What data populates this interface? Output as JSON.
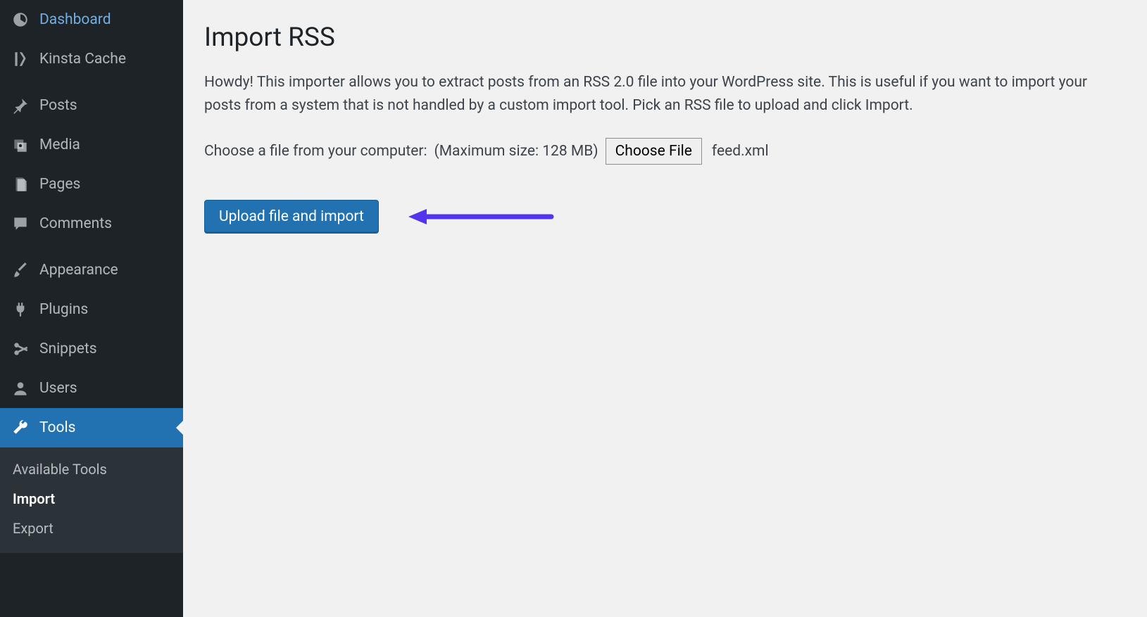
{
  "sidebar": {
    "items": [
      {
        "label": "Dashboard",
        "icon": "dashboard"
      },
      {
        "label": "Kinsta Cache",
        "icon": "kinsta"
      },
      {
        "label": "Posts",
        "icon": "pin"
      },
      {
        "label": "Media",
        "icon": "media"
      },
      {
        "label": "Pages",
        "icon": "pages"
      },
      {
        "label": "Comments",
        "icon": "comment"
      },
      {
        "label": "Appearance",
        "icon": "brush"
      },
      {
        "label": "Plugins",
        "icon": "plug"
      },
      {
        "label": "Snippets",
        "icon": "scissors"
      },
      {
        "label": "Users",
        "icon": "user"
      },
      {
        "label": "Tools",
        "icon": "wrench",
        "active": true
      }
    ],
    "submenu": [
      {
        "label": "Available Tools"
      },
      {
        "label": "Import",
        "current": true
      },
      {
        "label": "Export"
      }
    ]
  },
  "page": {
    "title": "Import RSS",
    "intro": "Howdy! This importer allows you to extract posts from an RSS 2.0 file into your WordPress site. This is useful if you want to import your posts from a system that is not handled by a custom import tool. Pick an RSS file to upload and click Import.",
    "choose_label": "Choose a file from your computer:",
    "max_size": "(Maximum size: 128 MB)",
    "choose_button": "Choose File",
    "filename": "feed.xml",
    "upload_button": "Upload file and import"
  },
  "colors": {
    "accent": "#2271b1",
    "annotation": "#5333ed"
  }
}
